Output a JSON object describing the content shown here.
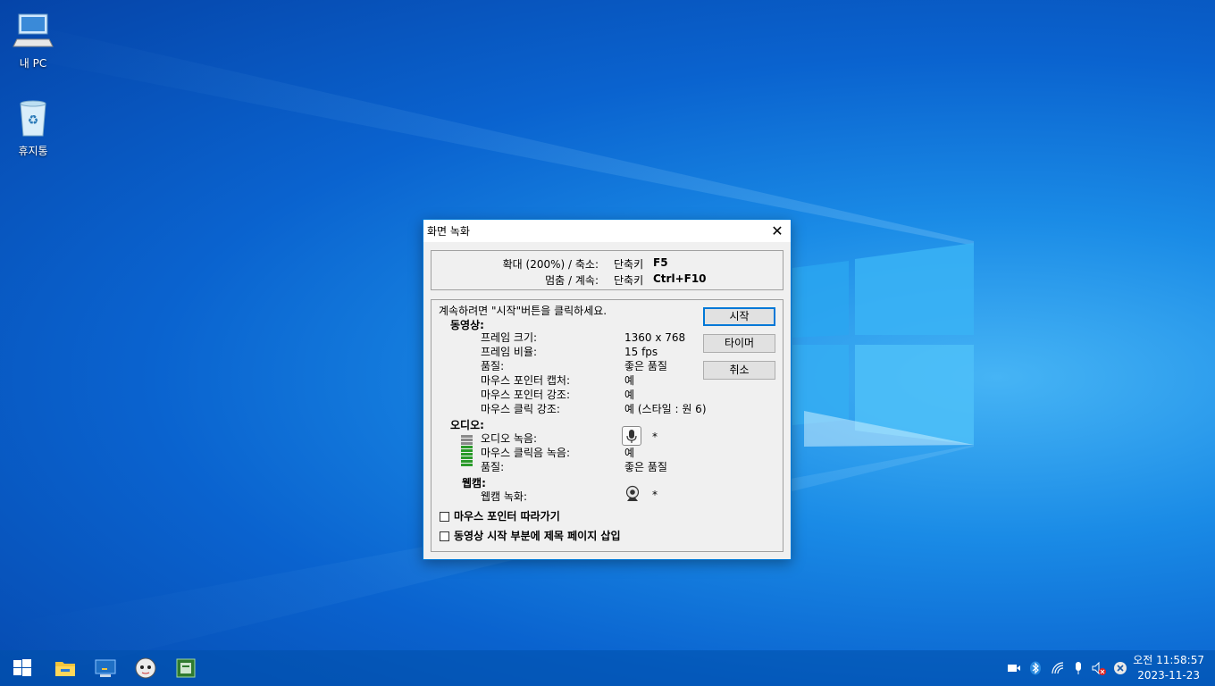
{
  "desktop": {
    "icons": [
      {
        "label": "내 PC"
      },
      {
        "label": "휴지통"
      }
    ]
  },
  "dialog": {
    "title": "화면 녹화",
    "hotkeys": [
      {
        "label": "확대 (200%) / 축소:",
        "kw": "단축키",
        "key": "F5"
      },
      {
        "label": "멈춤 / 계속:",
        "kw": "단축키",
        "key": "Ctrl+F10"
      }
    ],
    "instruction": "계속하려면 \"시작\"버튼을 클릭하세요.",
    "video": {
      "heading": "동영상:",
      "rows": [
        {
          "label": "프레임 크기:",
          "value": "1360 x 768"
        },
        {
          "label": "프레임 비율:",
          "value": "15 fps"
        },
        {
          "label": "품질:",
          "value": "좋은 품질"
        },
        {
          "label": "마우스 포인터 캡처:",
          "value": "예"
        },
        {
          "label": "마우스 포인터 강조:",
          "value": "예"
        },
        {
          "label": "마우스 클릭 강조:",
          "value": "예  (스타일 : 원 6)"
        }
      ]
    },
    "audio": {
      "heading": "오디오:",
      "rows": [
        {
          "label": "오디오 녹음:",
          "value": "*"
        },
        {
          "label": "마우스 클릭음 녹음:",
          "value": "예"
        },
        {
          "label": "품질:",
          "value": "좋은 품질"
        }
      ],
      "mic_icon": "microphone-icon",
      "meter_level": 0.5
    },
    "webcam": {
      "heading": "웹캠:",
      "rows": [
        {
          "label": "웹캠 녹화:",
          "value": "*"
        }
      ],
      "icon": "webcam-icon"
    },
    "buttons": {
      "start": "시작",
      "timer": "타이머",
      "cancel": "취소"
    },
    "checkboxes": [
      {
        "label": "마우스 포인터 따라가기",
        "checked": false
      },
      {
        "label": "동영상 시작 부분에 제목 페이지 삽입",
        "checked": false
      }
    ]
  },
  "taskbar": {
    "apps": [
      "windows-start-icon",
      "file-explorer-icon",
      "monitor-app-icon",
      "character-app-icon",
      "chip-app-icon"
    ],
    "tray": [
      "camera-icon",
      "bluetooth-icon",
      "wifi-icon",
      "microphone-icon",
      "volume-muted-icon",
      "close-circle-icon"
    ],
    "time": "오전 11:58:57",
    "date": "2023-11-23"
  },
  "colors": {
    "accent": "#0078d7",
    "meter_green": "#2a9a2a",
    "meter_gray": "#8a8a8a"
  }
}
